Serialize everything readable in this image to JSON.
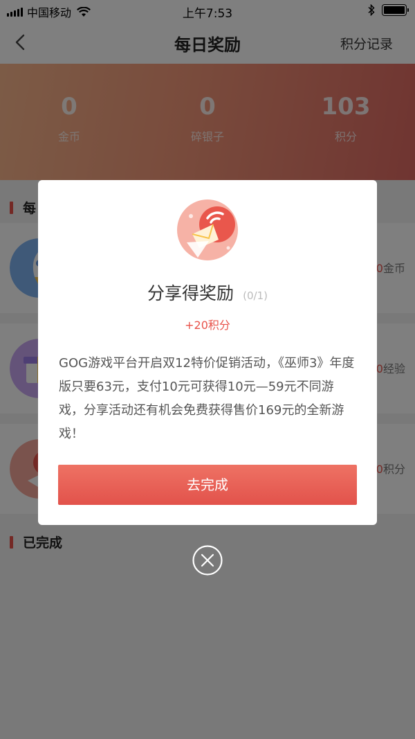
{
  "status_bar": {
    "carrier": "中国移动",
    "time": "上午7:53"
  },
  "navbar": {
    "title": "每日奖励",
    "action": "积分记录"
  },
  "stats": [
    {
      "value": "0",
      "label": "金币"
    },
    {
      "value": "0",
      "label": "碎银子"
    },
    {
      "value": "103",
      "label": "积分"
    }
  ],
  "sections": {
    "daily_visible": "每",
    "completed": "已完成"
  },
  "tasks": [
    {
      "reward_prefix": "0",
      "reward_unit": "金币",
      "icon": "rocket-icon"
    },
    {
      "reward_prefix": "0",
      "reward_unit": "经验",
      "icon": "gift-icon"
    },
    {
      "reward_prefix": "0",
      "reward_unit": "积分",
      "icon": "share-icon"
    }
  ],
  "modal": {
    "title": "分享得奖励",
    "progress": "(0/1)",
    "reward": "+20积分",
    "description": "GOG游戏平台开启双12特价促销活动，《巫师3》年度版只要63元，支付10元可获得10元—59元不同游戏，分享活动还有机会免费获得售价169元的全新游戏！",
    "button": "去完成",
    "icon": "share-reward-icon"
  },
  "colors": {
    "accent": "#e8524a",
    "banner_start": "#f9b78d",
    "banner_end": "#e06a63"
  }
}
